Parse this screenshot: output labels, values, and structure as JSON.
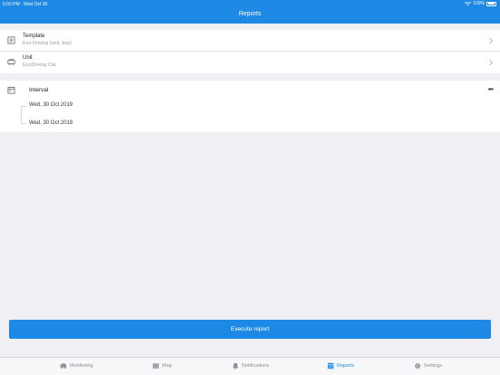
{
  "status_bar": {
    "time": "5:03 PM",
    "date": "Wed Oct 30",
    "battery": "100%"
  },
  "header": {
    "title": "Reports"
  },
  "report": {
    "template": {
      "label": "Template",
      "value": "Eco Driving (unit, day)"
    },
    "unit": {
      "label": "Unit",
      "value": "EcoDriving Car"
    }
  },
  "interval": {
    "label": "Interval",
    "from": "Wed, 30 Oct 2019",
    "to": "Wed, 30 Oct 2019",
    "more": "•••"
  },
  "actions": {
    "execute": "Execute report"
  },
  "tabs": [
    {
      "label": "Monitoring",
      "icon": "car-icon"
    },
    {
      "label": "Map",
      "icon": "map-icon"
    },
    {
      "label": "Notifications",
      "icon": "bell-icon"
    },
    {
      "label": "Reports",
      "icon": "reports-icon",
      "active": true
    },
    {
      "label": "Settings",
      "icon": "gear-icon"
    }
  ],
  "colors": {
    "accent": "#1e88e5",
    "background": "#efeff4"
  }
}
